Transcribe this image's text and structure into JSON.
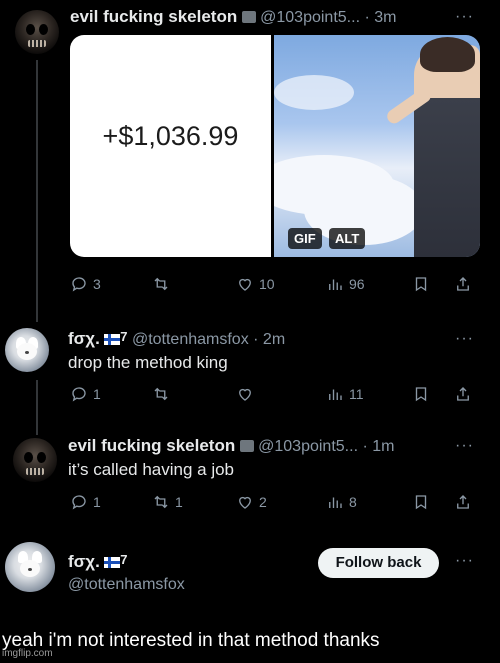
{
  "tweet1": {
    "name": "evil fucking skeleton",
    "handle": "@103point5...",
    "time": "· 3m",
    "more": "···",
    "media_amount": "+$1,036.99",
    "gif_label": "GIF",
    "alt_label": "ALT",
    "replies": "3",
    "retweets": "",
    "likes": "10",
    "views": "96"
  },
  "reply1": {
    "name": "fσχ.",
    "flag_suffix": "7",
    "handle": "@tottenhamsfox",
    "time": "· 2m",
    "text": "drop the method king",
    "more": "···",
    "replies": "1",
    "retweets": "",
    "likes": "",
    "views": "11"
  },
  "reply2": {
    "name": "evil fucking skeleton",
    "handle": "@103point5...",
    "time": "· 1m",
    "text": "it’s called having a job",
    "more": "···",
    "replies": "1",
    "retweets": "1",
    "likes": "2",
    "views": "8"
  },
  "profile": {
    "name": "fσχ.",
    "flag_suffix": "7",
    "handle": "@tottenhamsfox",
    "follow_label": "Follow back",
    "more": "···"
  },
  "caption": "yeah i'm not interested in that method thanks",
  "watermark": "imgflip.com",
  "icons": [
    "reply-icon",
    "retweet-icon",
    "like-icon",
    "views-icon",
    "bookmark-icon",
    "share-icon",
    "verified-badge-icon",
    "finland-flag-icon"
  ]
}
